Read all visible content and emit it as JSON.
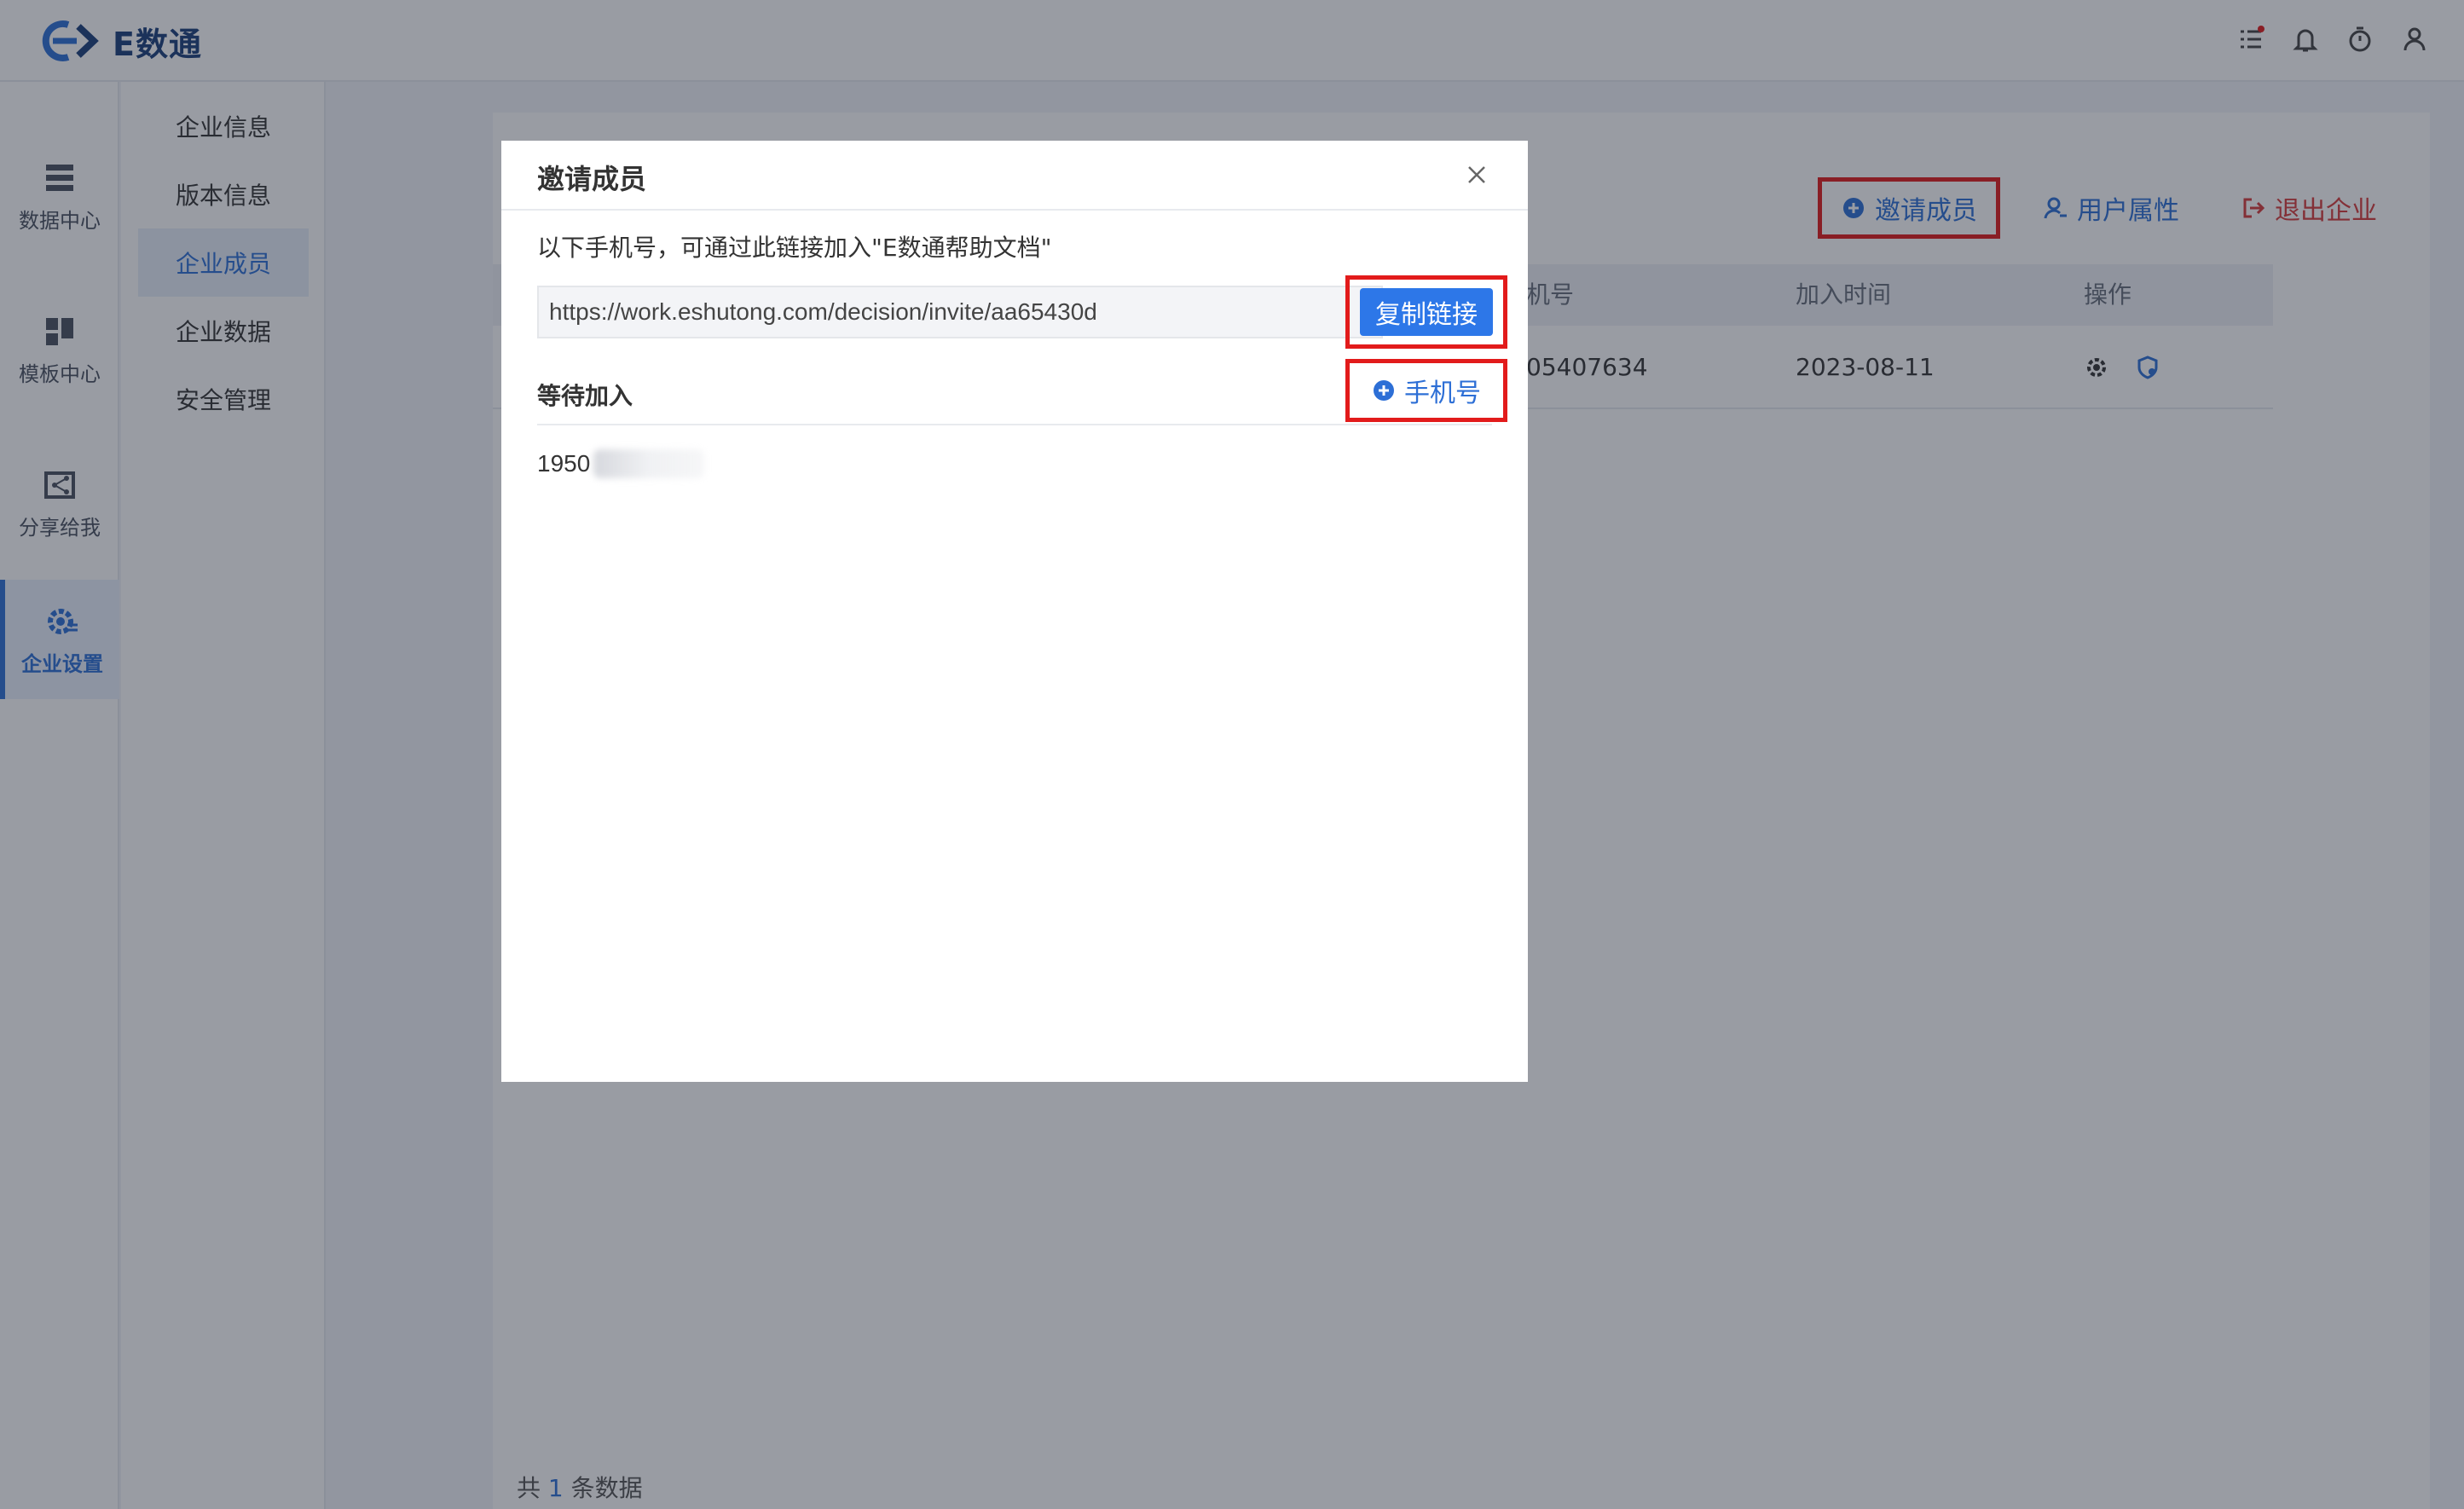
{
  "app": {
    "name": "E数通"
  },
  "rail": {
    "items": [
      {
        "label": "数据中心"
      },
      {
        "label": "模板中心"
      },
      {
        "label": "分享给我"
      },
      {
        "label": "企业设置"
      }
    ],
    "help": "?"
  },
  "submenu": {
    "items": [
      {
        "label": "企业信息"
      },
      {
        "label": "版本信息"
      },
      {
        "label": "企业成员"
      },
      {
        "label": "企业数据"
      },
      {
        "label": "安全管理"
      }
    ]
  },
  "toolbar": {
    "invite_label": "邀请成员",
    "attr_label": "用户属性",
    "exit_label": "退出企业"
  },
  "table": {
    "columns": [
      "机号",
      "加入时间",
      "操作"
    ],
    "rows": [
      {
        "phone_partial": "05407634",
        "join_time": "2023-08-11"
      }
    ]
  },
  "footer": {
    "prefix": "共",
    "count": "1",
    "suffix": "条数据"
  },
  "modal": {
    "title": "邀请成员",
    "description": "以下手机号，可通过此链接加入\"E数通帮助文档\"",
    "link": "https://work.eshutong.com/decision/invite/aa65430d",
    "copy_label": "复制链接",
    "waiting_title": "等待加入",
    "add_phone_label": "手机号",
    "waiting_items": [
      {
        "phone_visible": "1950"
      }
    ]
  },
  "colors": {
    "accent": "#2d6fd6",
    "danger": "#d83b3b",
    "highlight": "#e21b1b"
  }
}
